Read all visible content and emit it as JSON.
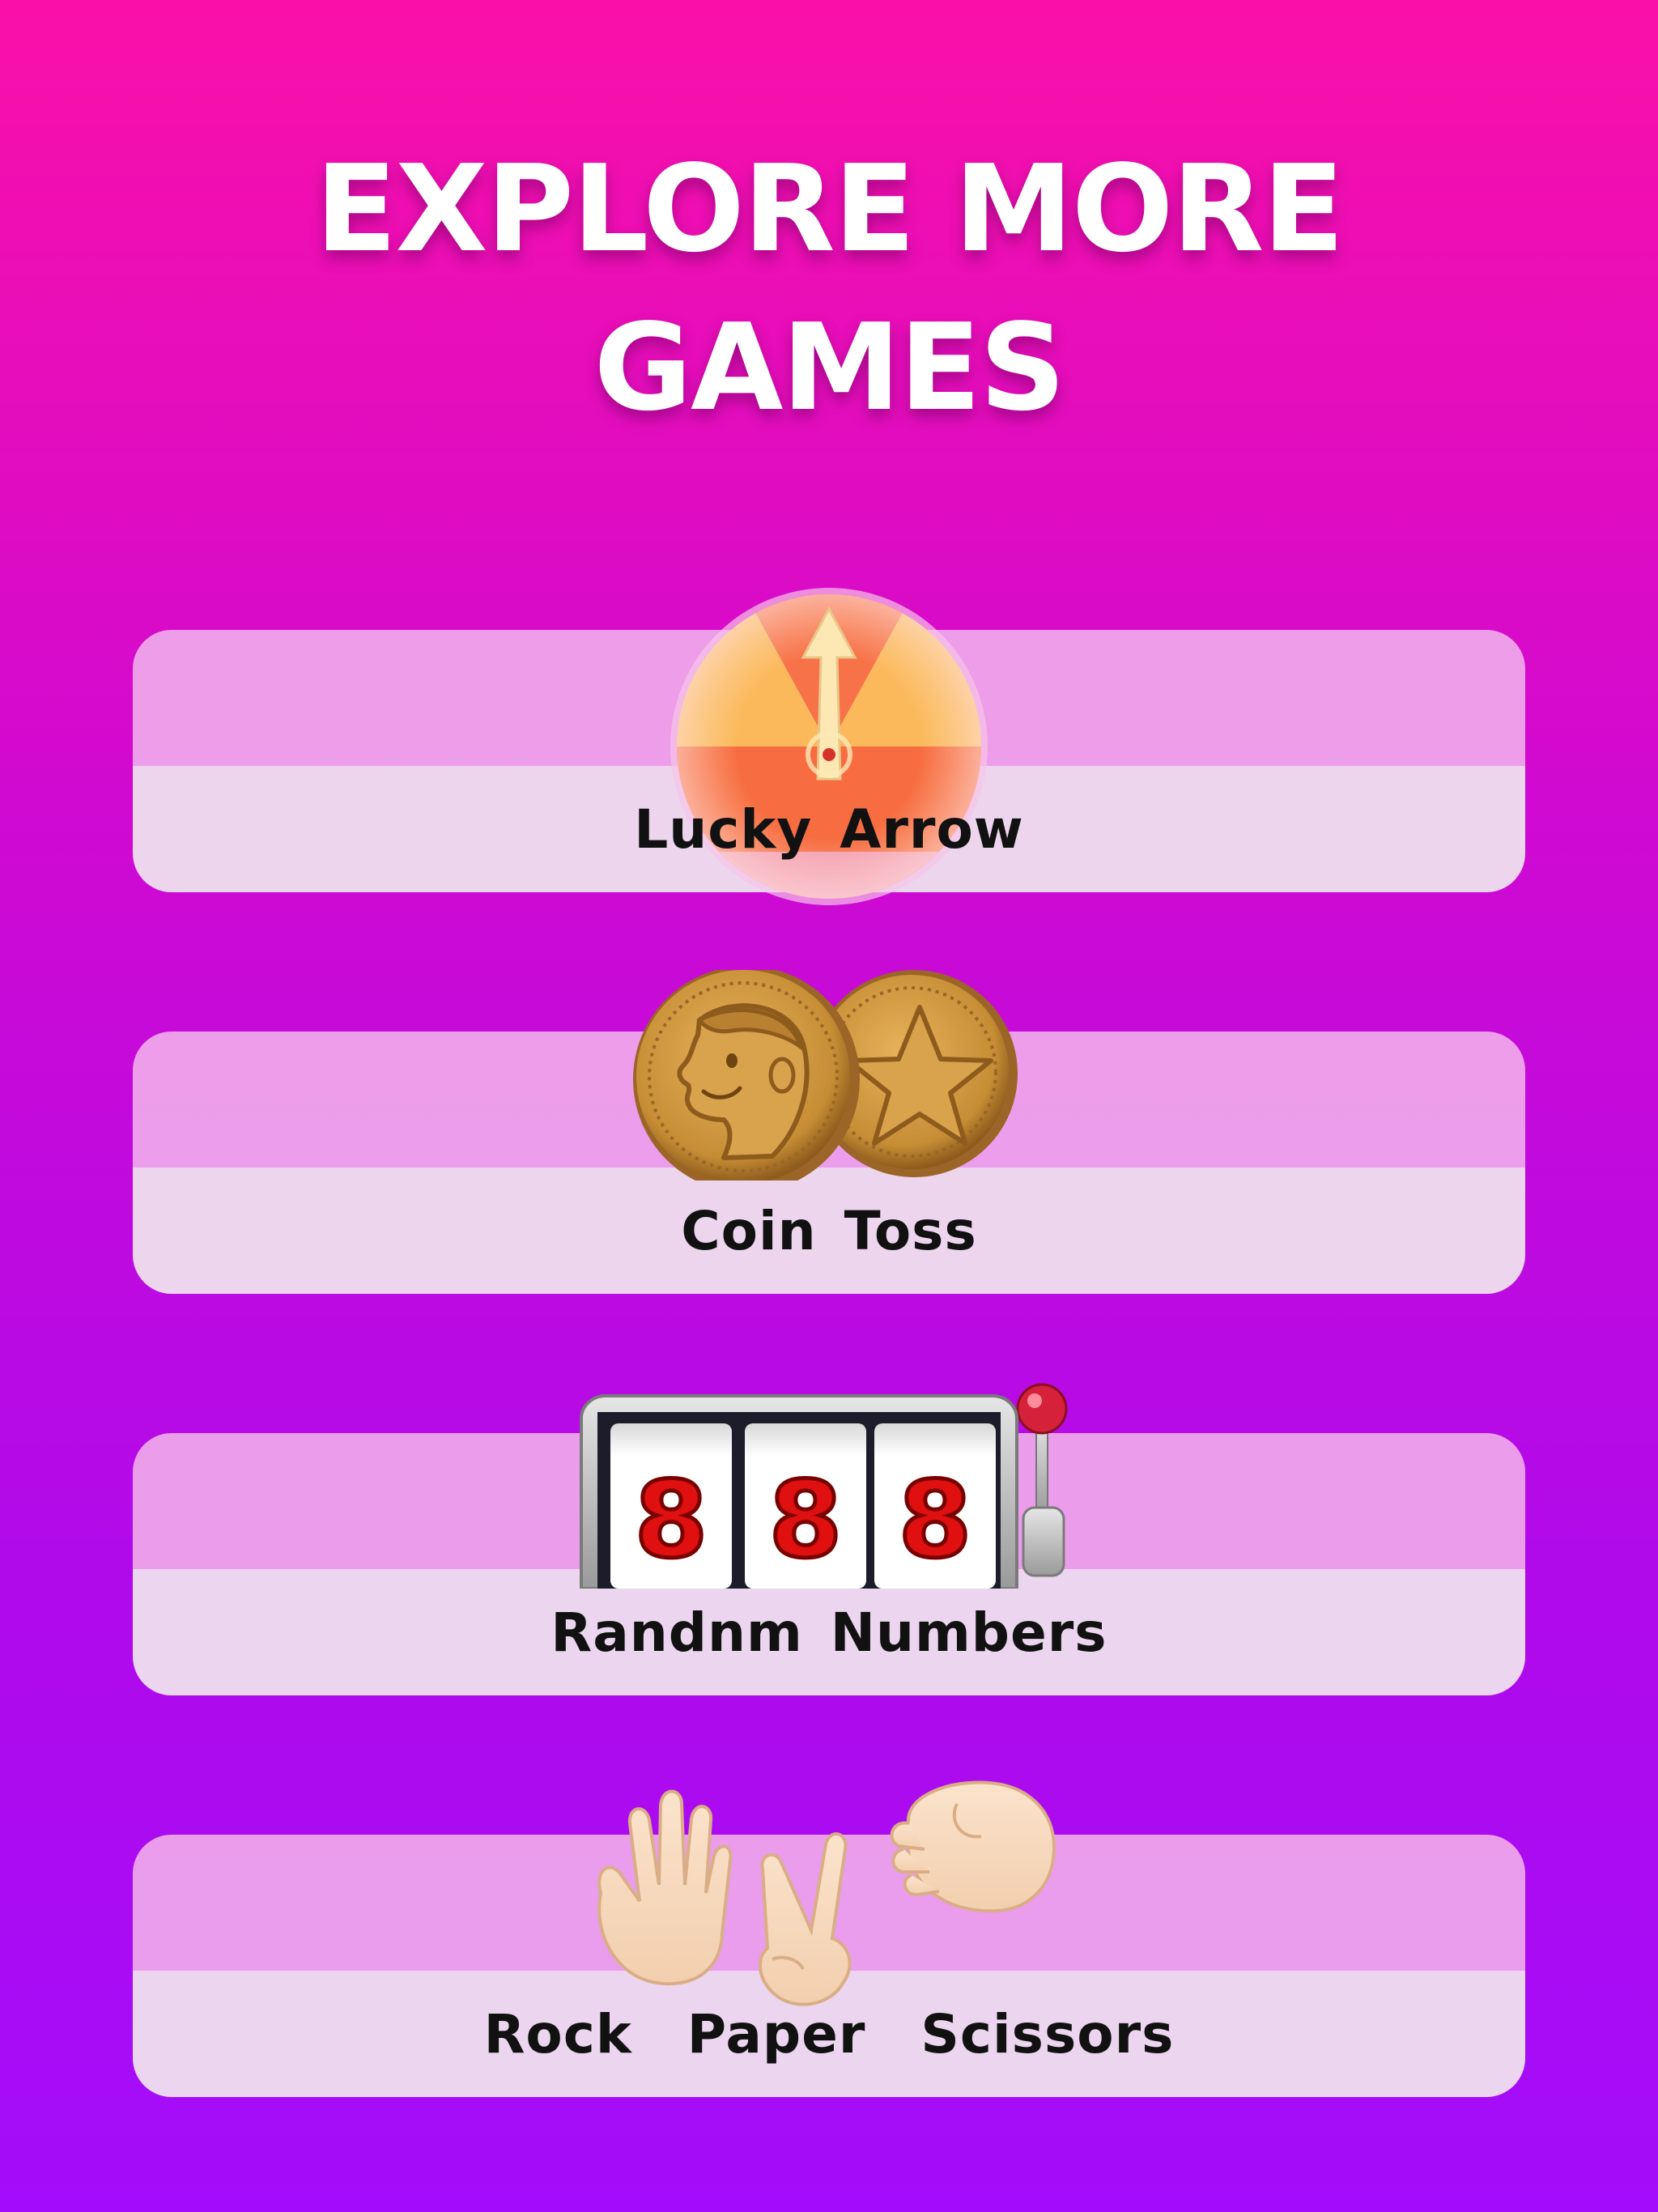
{
  "header": {
    "title_line1": "EXPLORE MORE",
    "title_line2": "GAMES"
  },
  "games": [
    {
      "label": "Lucky Arrow",
      "icon": "spinning-arrow-wheel-icon"
    },
    {
      "label": "Coin Toss",
      "icon": "coins-icon"
    },
    {
      "label": "Randnm Numbers",
      "icon": "slot-machine-icon",
      "slot_digits": [
        "8",
        "8",
        "8"
      ]
    },
    {
      "label": "Rock  Paper  Scissors",
      "icon": "hand-gestures-icon"
    }
  ],
  "colors": {
    "background_top": "#fa10a8",
    "background_bottom": "#a30cfa",
    "card_top": "#f0aaeb",
    "card_bottom": "#eedeee",
    "label_text": "#111111",
    "title_text": "#ffffff"
  }
}
